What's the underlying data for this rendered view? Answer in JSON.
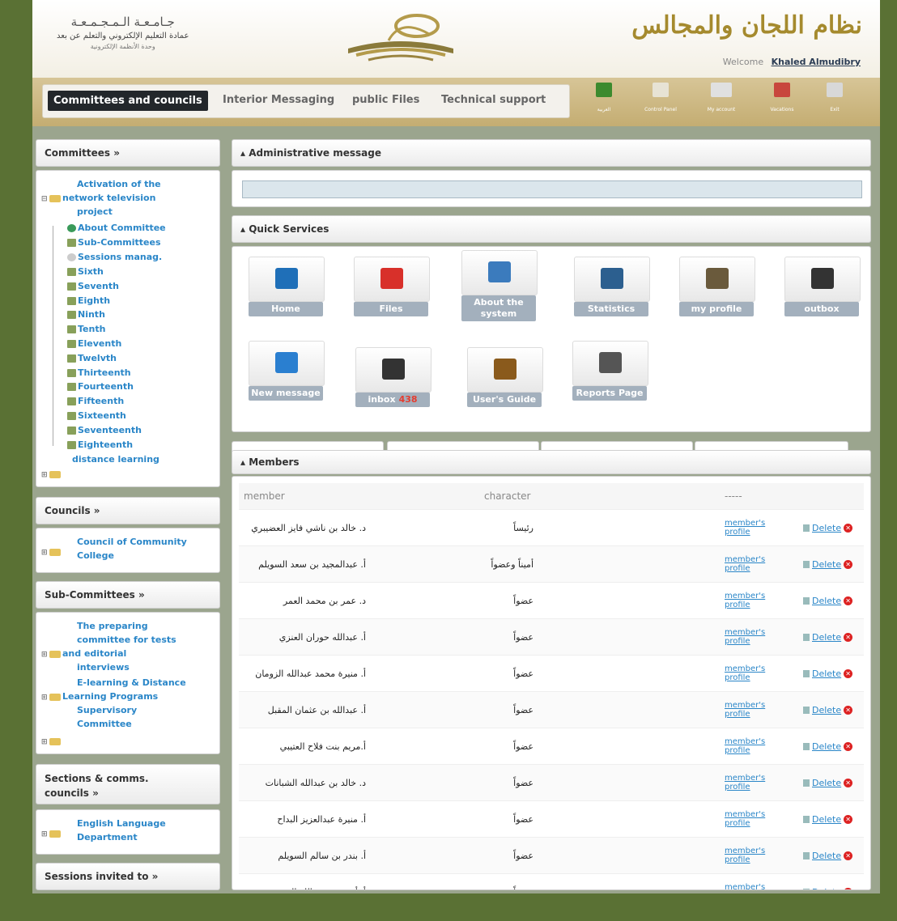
{
  "header": {
    "university": "جـامـعـة الـمـجـمـعـة",
    "deanship": "عمادة التعليم الإلكتروني والتعلم عن بعد",
    "unit": "وحدة الأنظمة الإلكترونية",
    "app_title": "نظام اللجان والمجالس",
    "welcome_label": "Welcome",
    "user_name": "Khaled Almudibry"
  },
  "nav": {
    "tabs": [
      "Committees and councils",
      "Interior Messaging",
      "public Files",
      "Technical support"
    ],
    "icons": [
      {
        "label": "العربية",
        "icon": "arabic-language-icon",
        "color": "#3c8a2e"
      },
      {
        "label": "Control Panel",
        "icon": "control-panel-icon",
        "color": "#e7e3d5"
      },
      {
        "label": "My account",
        "icon": "my-account-icon",
        "color": "#e0e0e0"
      },
      {
        "label": "Vacations",
        "icon": "vacations-icon",
        "color": "#c8463d"
      },
      {
        "label": "Exit",
        "icon": "exit-icon",
        "color": "#d8d8d8"
      }
    ]
  },
  "sidebar": {
    "committees": {
      "title": "Committees »",
      "root": "Activation of the network television project",
      "root_lines": [
        "Activation of the",
        "network television",
        "project"
      ],
      "children": [
        "About Committee",
        "Sub-Committees",
        "Sessions manag."
      ],
      "sessions": [
        "Sixth",
        "Seventh",
        "Eighth",
        "Ninth",
        "Tenth",
        "Eleventh",
        "Twelvth",
        "Thirteenth",
        "Fourteenth",
        "Fifteenth",
        "Sixteenth",
        "Seventeenth",
        "Eighteenth"
      ],
      "second": "distance learning"
    },
    "councils": {
      "title": "Councils »",
      "item_lines": [
        "Council of Community",
        "College"
      ]
    },
    "subcommittees": {
      "title": "Sub-Committees »",
      "item1_lines": [
        "The preparing",
        "committee for tests",
        "and editorial",
        "interviews"
      ],
      "item2_lines": [
        "E-learning & Distance",
        "Learning Programs",
        "Supervisory",
        "Committee"
      ]
    },
    "sections": {
      "title_lines": [
        "Sections & comms.",
        "councils »"
      ],
      "item_lines": [
        "English Language",
        "Department"
      ]
    },
    "sessions_invited": {
      "title": "Sessions invited to »"
    }
  },
  "main": {
    "admin_title": "Administrative message",
    "quick_title": "Quick Services",
    "services": [
      {
        "label": "Home",
        "icon": "monitor-icon",
        "color": "#1f6fb8"
      },
      {
        "label": "Files",
        "icon": "pdf-file-icon",
        "color": "#d8302a"
      },
      {
        "label": "About the system",
        "icon": "about-system-icon",
        "color": "#3b7bbd"
      },
      {
        "label": "Statistics",
        "icon": "statistics-icon",
        "color": "#2c5f8f"
      },
      {
        "label": "my profile",
        "icon": "user-profile-icon",
        "color": "#6a5a3c"
      },
      {
        "label": "outbox",
        "icon": "outbox-icon",
        "color": "#333333"
      },
      {
        "label": "New message",
        "icon": "new-message-icon",
        "color": "#2a7fd0"
      },
      {
        "label": "inbox",
        "badge": "438",
        "icon": "inbox-icon",
        "color": "#333333"
      },
      {
        "label": "User's Guide",
        "icon": "users-guide-icon",
        "color": "#8a5a1c"
      },
      {
        "label": "Reports Page",
        "icon": "printer-icon",
        "color": "#555555"
      }
    ],
    "members": {
      "title": "Members",
      "columns": [
        "member",
        "character",
        "-----"
      ],
      "link_profile_lines": [
        "member's",
        "profile"
      ],
      "delete_label": "Delete",
      "rows": [
        {
          "name": "د. خالد بن ناشي فايز العضيبري",
          "role": "رئيساً"
        },
        {
          "name": "أ. عبدالمجيد بن سعد السويلم",
          "role": "أميناً وعضواً"
        },
        {
          "name": "د. عمر بن محمد العمر",
          "role": "عضواً"
        },
        {
          "name": "أ. عبدالله حوران العنزي",
          "role": "عضواً"
        },
        {
          "name": "أ. منيرة محمد عبدالله الزومان",
          "role": "عضواً"
        },
        {
          "name": "أ. عبدالله بن عثمان المقبل",
          "role": "عضواً"
        },
        {
          "name": "أ.مريم بنت فلاح العتيبي",
          "role": "عضواً"
        },
        {
          "name": "د. خالد بن عبدالله الشبانات",
          "role": "عضواً"
        },
        {
          "name": "أ. منيرة عبدالعزيز البداح",
          "role": "عضواً"
        },
        {
          "name": "أ. بندر بن سالم السويلم",
          "role": "عضواً"
        },
        {
          "name": "أ. أحمد بن عبدالله الحمد",
          "role": "عضواً"
        }
      ]
    }
  }
}
